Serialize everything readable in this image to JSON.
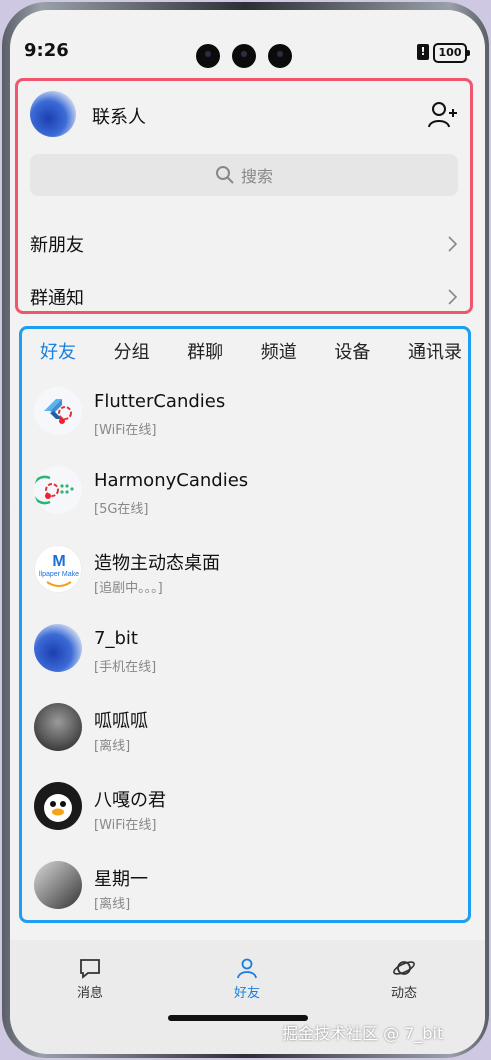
{
  "status_bar": {
    "time": "9:26",
    "battery": "100",
    "alert": "!"
  },
  "header": {
    "title": "联系人"
  },
  "search": {
    "placeholder": "搜索"
  },
  "rows": {
    "new_friends": "新朋友",
    "group_notice": "群通知"
  },
  "tabs": [
    {
      "label": "好友",
      "active": true
    },
    {
      "label": "分组"
    },
    {
      "label": "群聊"
    },
    {
      "label": "频道"
    },
    {
      "label": "设备"
    },
    {
      "label": "通讯录"
    }
  ],
  "friends": [
    {
      "name": "FlutterCandies",
      "status": "[WiFi在线]",
      "avatar": "flutter-candies-logo"
    },
    {
      "name": "HarmonyCandies",
      "status": "[5G在线]",
      "avatar": "harmony-candies-logo"
    },
    {
      "name": "造物主动态桌面",
      "status": "[追剧中。。。]",
      "avatar": "wallpaper-maker-logo",
      "avatar_text": "llpaper Make"
    },
    {
      "name": "7_bit",
      "status": "[手机在线]",
      "avatar": "blue-dress-figure"
    },
    {
      "name": "呱呱呱",
      "status": "[离线]",
      "avatar": "dark-photo"
    },
    {
      "name": "八嘎の君",
      "status": "[WiFi在线]",
      "avatar": "penguin-face"
    },
    {
      "name": "星期一",
      "status": "[离线]",
      "avatar": "monday-photo"
    }
  ],
  "bottom_nav": [
    {
      "label": "消息",
      "icon": "message-icon"
    },
    {
      "label": "好友",
      "icon": "person-icon",
      "active": true
    },
    {
      "label": "动态",
      "icon": "planet-icon"
    }
  ],
  "watermark": "掘金技术社区 @ 7_bit",
  "colors": {
    "accent": "#1a7fe0",
    "top_border": "#f0566d",
    "list_border": "#1c9ff2"
  }
}
